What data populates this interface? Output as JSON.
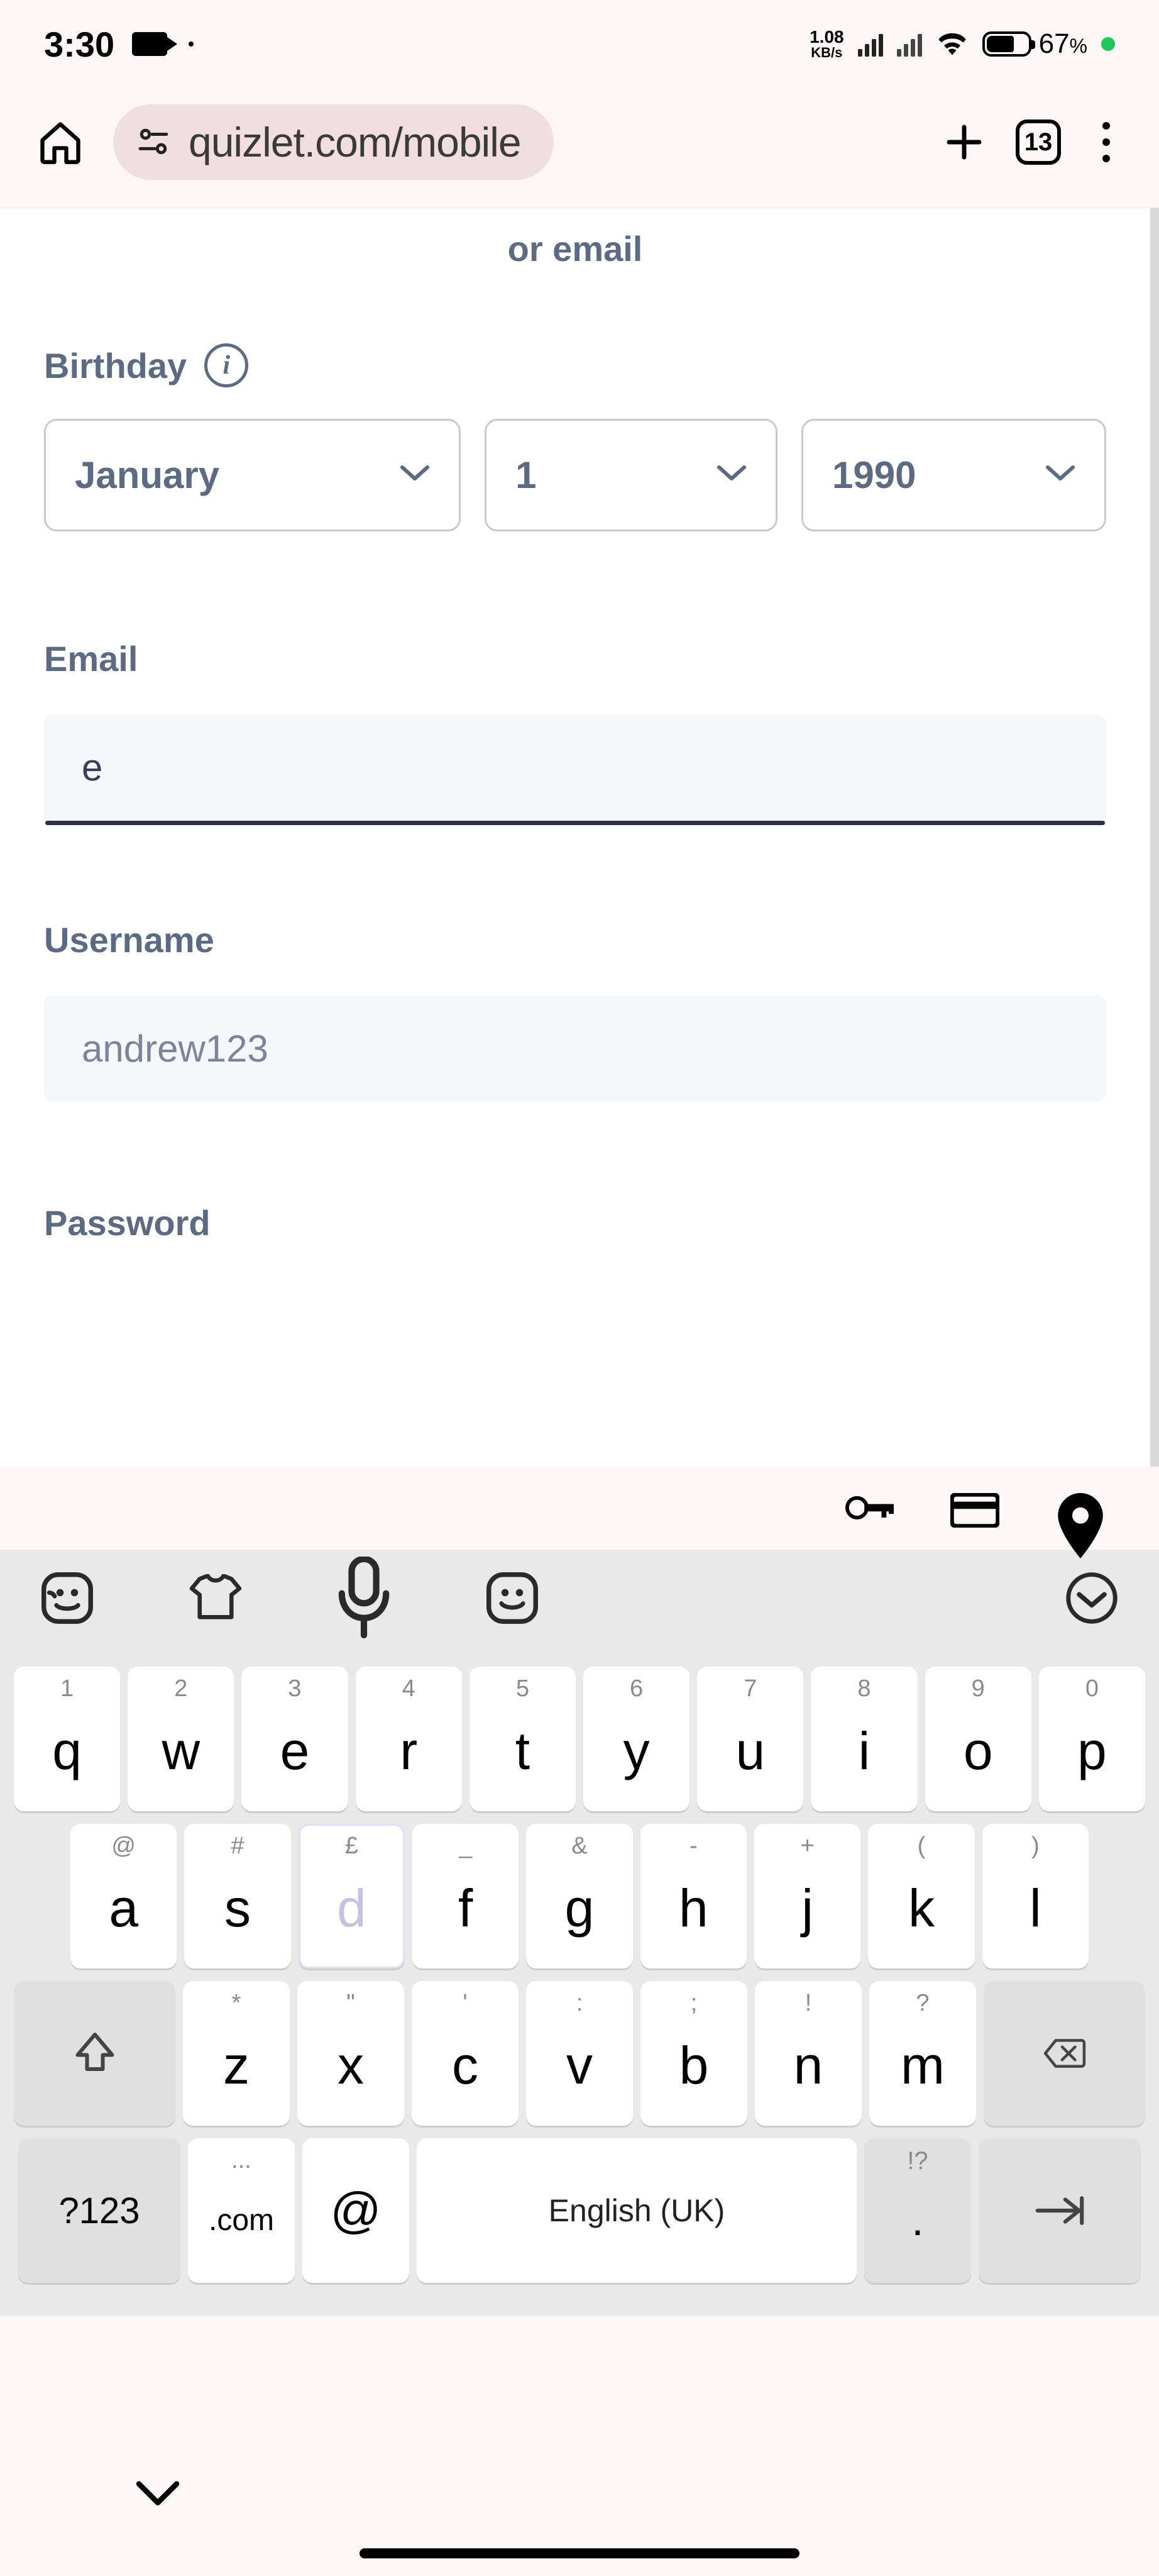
{
  "status": {
    "time": "3:30",
    "net_speed_value": "1.08",
    "net_speed_unit": "KB/s",
    "battery_pct": "67"
  },
  "browser": {
    "url": "quizlet.com/mobile",
    "tab_count": "13"
  },
  "page": {
    "or_email": "or email",
    "birthday_label": "Birthday",
    "month": "January",
    "day": "1",
    "year": "1990",
    "email_label": "Email",
    "email_value": "e",
    "username_label": "Username",
    "username_placeholder": "andrew123",
    "password_label": "Password"
  },
  "keyboard": {
    "row1": [
      {
        "sub": "1",
        "main": "q"
      },
      {
        "sub": "2",
        "main": "w"
      },
      {
        "sub": "3",
        "main": "e"
      },
      {
        "sub": "4",
        "main": "r"
      },
      {
        "sub": "5",
        "main": "t"
      },
      {
        "sub": "6",
        "main": "y"
      },
      {
        "sub": "7",
        "main": "u"
      },
      {
        "sub": "8",
        "main": "i"
      },
      {
        "sub": "9",
        "main": "o"
      },
      {
        "sub": "0",
        "main": "p"
      }
    ],
    "row2": [
      {
        "sub": "@",
        "main": "a"
      },
      {
        "sub": "#",
        "main": "s"
      },
      {
        "sub": "£",
        "main": "d"
      },
      {
        "sub": "_",
        "main": "f"
      },
      {
        "sub": "&",
        "main": "g"
      },
      {
        "sub": "-",
        "main": "h"
      },
      {
        "sub": "+",
        "main": "j"
      },
      {
        "sub": "(",
        "main": "k"
      },
      {
        "sub": ")",
        "main": "l"
      }
    ],
    "row3": [
      {
        "sub": "*",
        "main": "z"
      },
      {
        "sub": "\"",
        "main": "x"
      },
      {
        "sub": "'",
        "main": "c"
      },
      {
        "sub": ":",
        "main": "v"
      },
      {
        "sub": ";",
        "main": "b"
      },
      {
        "sub": "!",
        "main": "n"
      },
      {
        "sub": "?",
        "main": "m"
      }
    ],
    "sym_key": "?123",
    "com_key": ".com",
    "com_sub": "...",
    "at_key": "@",
    "space_label": "English (UK)",
    "punct_main": ".",
    "punct_sub": "!?"
  }
}
